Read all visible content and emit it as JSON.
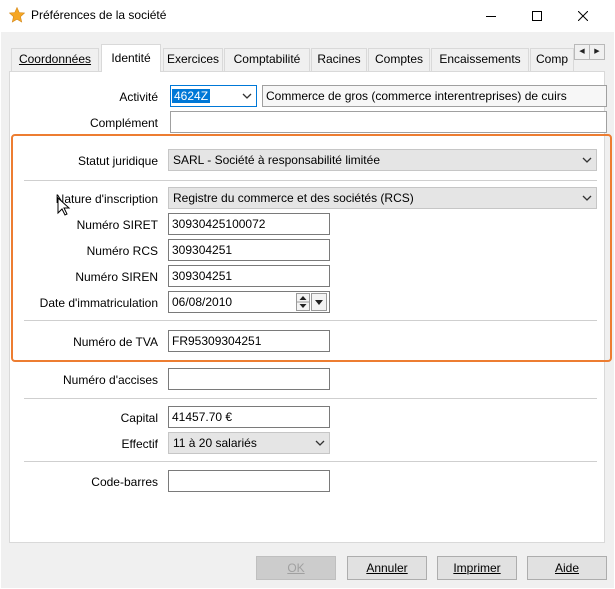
{
  "window": {
    "title": "Préférences de la société",
    "icon": "star-icon",
    "controls": [
      "minimize-icon",
      "maximize-icon",
      "close-icon"
    ]
  },
  "tabs": [
    {
      "label": "Coordonnées",
      "active": false
    },
    {
      "label": "Identité",
      "active": true
    },
    {
      "label": "Exercices",
      "active": false
    },
    {
      "label": "Comptabilité",
      "active": false
    },
    {
      "label": "Racines",
      "active": false
    },
    {
      "label": "Comptes",
      "active": false
    },
    {
      "label": "Encaissements",
      "active": false
    },
    {
      "label": "Comp",
      "active": false
    }
  ],
  "form": {
    "activite_label": "Activité",
    "activite_code": "4624Z",
    "activite_desc": "Commerce de gros (commerce interentreprises) de cuirs",
    "complement_label": "Complément",
    "complement_value": "",
    "statut_label": "Statut juridique",
    "statut_value": "SARL - Société à responsabilité limitée",
    "nature_label": "Nature d'inscription",
    "nature_value": "Registre du commerce et des sociétés (RCS)",
    "siret_label": "Numéro SIRET",
    "siret_value": "30930425100072",
    "rcs_label": "Numéro RCS",
    "rcs_value": "309304251",
    "siren_label": "Numéro SIREN",
    "siren_value": "309304251",
    "immat_label": "Date d'immatriculation",
    "immat_value": "06/08/2010",
    "tva_label": "Numéro de TVA",
    "tva_value": "FR95309304251",
    "accises_label": "Numéro d'accises",
    "accises_value": "",
    "capital_label": "Capital",
    "capital_value": "41457.70 €",
    "effectif_label": "Effectif",
    "effectif_value": "11 à 20 salariés",
    "codebarres_label": "Code-barres",
    "codebarres_value": ""
  },
  "buttons": {
    "ok": "OK",
    "annuler": "Annuler",
    "imprimer": "Imprimer",
    "aide": "Aide"
  },
  "colors": {
    "highlight": "#ed7d31",
    "selection": "#0078d7",
    "star": "#f5a623"
  }
}
